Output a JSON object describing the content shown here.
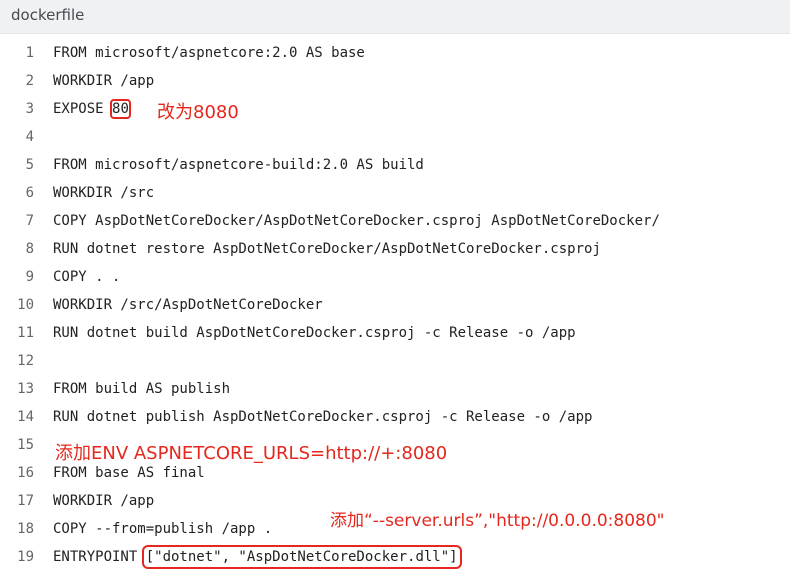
{
  "header": {
    "title": "dockerfile"
  },
  "lines": [
    {
      "num": "1",
      "text": "FROM microsoft/aspnetcore:2.0 AS base"
    },
    {
      "num": "2",
      "text": "WORKDIR /app"
    },
    {
      "num": "3",
      "pre": "EXPOSE ",
      "highlight": "80"
    },
    {
      "num": "4",
      "text": ""
    },
    {
      "num": "5",
      "text": "FROM microsoft/aspnetcore-build:2.0 AS build"
    },
    {
      "num": "6",
      "text": "WORKDIR /src"
    },
    {
      "num": "7",
      "text": "COPY AspDotNetCoreDocker/AspDotNetCoreDocker.csproj AspDotNetCoreDocker/"
    },
    {
      "num": "8",
      "text": "RUN dotnet restore AspDotNetCoreDocker/AspDotNetCoreDocker.csproj"
    },
    {
      "num": "9",
      "text": "COPY . ."
    },
    {
      "num": "10",
      "text": "WORKDIR /src/AspDotNetCoreDocker"
    },
    {
      "num": "11",
      "text": "RUN dotnet build AspDotNetCoreDocker.csproj -c Release -o /app"
    },
    {
      "num": "12",
      "text": ""
    },
    {
      "num": "13",
      "text": "FROM build AS publish"
    },
    {
      "num": "14",
      "text": "RUN dotnet publish AspDotNetCoreDocker.csproj -c Release -o /app"
    },
    {
      "num": "15",
      "text": ""
    },
    {
      "num": "16",
      "text": "FROM base AS final"
    },
    {
      "num": "17",
      "text": "WORKDIR /app"
    },
    {
      "num": "18",
      "text": "COPY --from=publish /app ."
    },
    {
      "num": "19",
      "pre": "ENTRYPOINT ",
      "highlight": "[\"dotnet\", \"AspDotNetCoreDocker.dll\"]"
    }
  ],
  "annotations": {
    "line3": "改为8080",
    "line15": "添加ENV ASPNETCORE_URLS=http://+:8080",
    "line18": "添加“--server.urls”,\"http://0.0.0.0:8080\""
  },
  "colors": {
    "annotation": "#e5271d",
    "header_bg": "#f0f1f3"
  }
}
